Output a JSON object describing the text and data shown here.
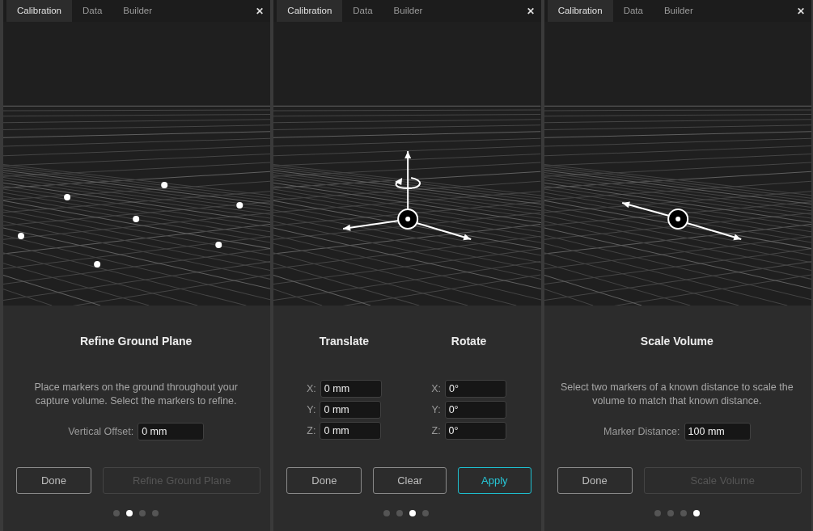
{
  "panels": [
    {
      "tabs": [
        {
          "label": "Calibration",
          "selected": true
        },
        {
          "label": "Data",
          "selected": false
        },
        {
          "label": "Builder",
          "selected": false
        }
      ],
      "close": "✕",
      "scene": {
        "kind": "markers"
      },
      "sections": [
        {
          "title": "Refine Ground Plane",
          "description": "Place markers on the ground throughout your capture volume. Select the markers to refine.",
          "fields": [
            {
              "label": "Vertical Offset:",
              "value": "0 mm"
            }
          ]
        }
      ],
      "buttons": [
        {
          "label": "Done",
          "disabled": false,
          "primary": false
        },
        {
          "label": "Refine Ground Plane",
          "disabled": true,
          "primary": false
        }
      ],
      "pages": [
        {
          "selected": false
        },
        {
          "selected": true
        },
        {
          "selected": false
        },
        {
          "selected": false
        }
      ]
    },
    {
      "tabs": [
        {
          "label": "Calibration",
          "selected": true
        },
        {
          "label": "Data",
          "selected": false
        },
        {
          "label": "Builder",
          "selected": false
        }
      ],
      "close": "✕",
      "scene": {
        "kind": "gizmo"
      },
      "sections": [
        {
          "title": "Translate",
          "fields": [
            {
              "label": "X:",
              "value": "0 mm"
            },
            {
              "label": "Y:",
              "value": "0 mm"
            },
            {
              "label": "Z:",
              "value": "0 mm"
            }
          ]
        },
        {
          "title": "Rotate",
          "fields": [
            {
              "label": "X:",
              "value": "0°"
            },
            {
              "label": "Y:",
              "value": "0°"
            },
            {
              "label": "Z:",
              "value": "0°"
            }
          ]
        }
      ],
      "buttons": [
        {
          "label": "Done",
          "disabled": false,
          "primary": false
        },
        {
          "label": "Clear",
          "disabled": false,
          "primary": false
        },
        {
          "label": "Apply",
          "disabled": false,
          "primary": true
        }
      ],
      "pages": [
        {
          "selected": false
        },
        {
          "selected": false
        },
        {
          "selected": true
        },
        {
          "selected": false
        }
      ]
    },
    {
      "tabs": [
        {
          "label": "Calibration",
          "selected": true
        },
        {
          "label": "Data",
          "selected": false
        },
        {
          "label": "Builder",
          "selected": false
        }
      ],
      "close": "✕",
      "scene": {
        "kind": "scale"
      },
      "sections": [
        {
          "title": "Scale Volume",
          "description": "Select two markers of a known distance to scale the volume to match that known distance.",
          "fields": [
            {
              "label": "Marker Distance:",
              "value": "100 mm"
            }
          ]
        }
      ],
      "buttons": [
        {
          "label": "Done",
          "disabled": false,
          "primary": false
        },
        {
          "label": "Scale Volume",
          "disabled": true,
          "primary": false
        }
      ],
      "pages": [
        {
          "selected": false
        },
        {
          "selected": false
        },
        {
          "selected": false
        },
        {
          "selected": true
        }
      ]
    }
  ]
}
